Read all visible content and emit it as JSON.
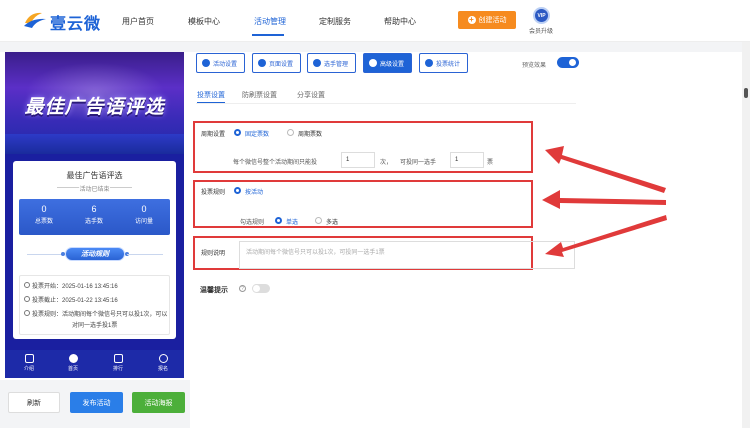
{
  "header": {
    "logo_text": "壹云微",
    "nav": [
      "用户首页",
      "模板中心",
      "活动管理",
      "定制服务",
      "帮助中心"
    ],
    "active_nav": "活动管理",
    "create_button": "创建活动",
    "vip_badge": "VIP",
    "vip_label": "会员升级"
  },
  "colors": {
    "primary": "#1e63d6",
    "orange": "#f68b1f",
    "green": "#4caf3a",
    "red": "#e03a3a"
  },
  "preview": {
    "banner_title": "最佳广告语评选",
    "card_title": "最佳广告语评选",
    "status": "活动已结束",
    "stats": [
      {
        "value": "0",
        "label": "总票数"
      },
      {
        "value": "6",
        "label": "选手数"
      },
      {
        "value": "0",
        "label": "访问量"
      }
    ],
    "rule_button": "活动规则",
    "info": {
      "start": "投票开始：2025-01-16 13:45:16",
      "end": "投票截止：2025-01-22 13:45:16",
      "rule_line1": "投票规则：活动期间每个微信号只可以投1次，可以",
      "rule_line2": "对同一选手投1票"
    },
    "tabs": [
      "介绍",
      "首页",
      "排行",
      "报名"
    ]
  },
  "bottom_buttons": {
    "refresh": "刷新",
    "publish": "发布活动",
    "poster": "活动海报"
  },
  "toolbar": {
    "buttons": [
      "活动设置",
      "页面设置",
      "选手管理",
      "高级设置",
      "投票统计"
    ],
    "active": "高级设置",
    "preview_label": "预览效果",
    "preview_on": true
  },
  "subtabs": [
    "投票设置",
    "防刷票设置",
    "分享设置"
  ],
  "active_subtab": "投票设置",
  "form": {
    "period": {
      "label": "周期设置",
      "options": [
        "固定票数",
        "周期票数"
      ],
      "selected": "固定票数",
      "text1": "每个微信号整个活动期间只能投",
      "count1": "1",
      "unit1": "次，",
      "text2": "可投同一选手",
      "count2": "1",
      "unit2": "票"
    },
    "rule": {
      "label": "投票规则",
      "option": "按活动",
      "choice_label": "勾选规则",
      "choices": [
        "单选",
        "多选"
      ],
      "selected": "单选"
    },
    "desc": {
      "label": "规则说明",
      "value": "活动期间每个微信号只可以投1次，可投同一选手1票"
    },
    "hint": {
      "label": "温馨提示",
      "help": "?",
      "on": false
    }
  }
}
